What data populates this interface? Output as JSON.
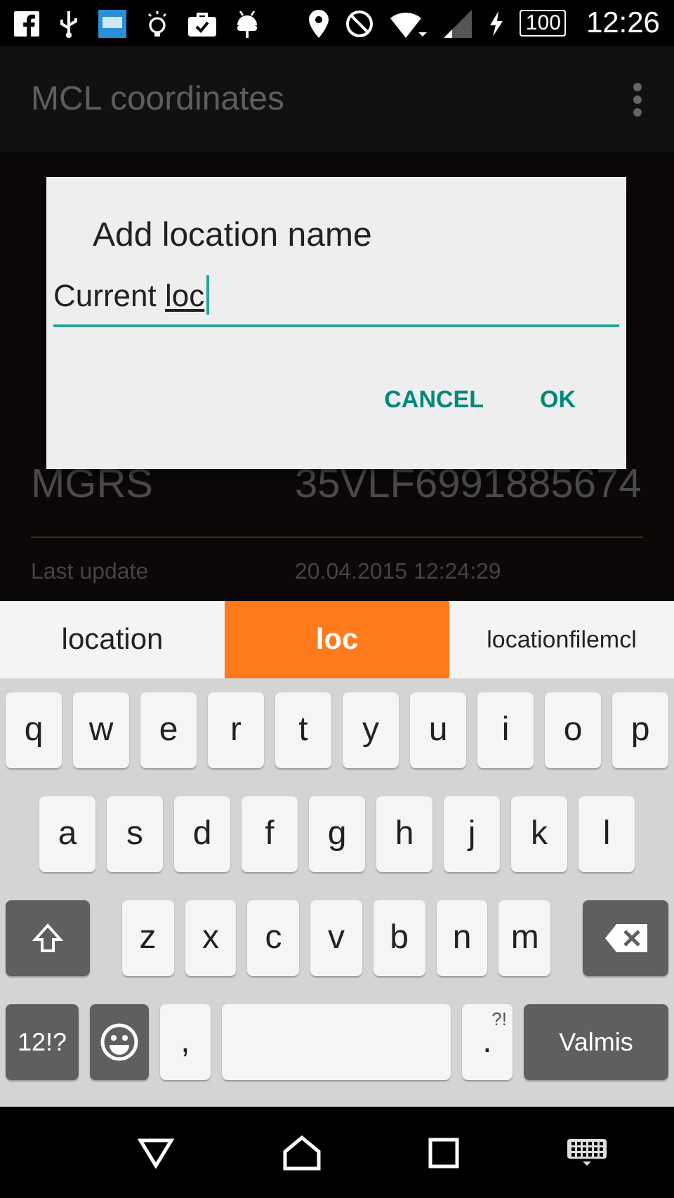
{
  "status_bar": {
    "notifications": [
      {
        "kind": "facebook"
      },
      {
        "kind": "usb"
      },
      {
        "kind": "app"
      },
      {
        "kind": "bulb"
      },
      {
        "kind": "briefcase"
      },
      {
        "kind": "android"
      }
    ],
    "system": [
      {
        "kind": "location"
      },
      {
        "kind": "block"
      },
      {
        "kind": "wifi"
      },
      {
        "kind": "signal"
      },
      {
        "kind": "charging"
      }
    ],
    "battery": "100",
    "time": "12:26"
  },
  "app_bar": {
    "title": "MCL coordinates"
  },
  "content": {
    "rows": [
      {
        "label": "MGRS",
        "value": "35VLF6991885674"
      }
    ],
    "details": [
      {
        "label": "Last update",
        "value": "20.04.2015 12:24:29"
      }
    ]
  },
  "dialog": {
    "title": "Add location name",
    "field": {
      "value": "Current ",
      "composing": "loc"
    },
    "buttons": [
      "CANCEL",
      "OK"
    ]
  },
  "keyboard": {
    "suggestions": [
      {
        "text": "location",
        "selected": false
      },
      {
        "text": "loc",
        "selected": true
      },
      {
        "text": "locationfilemcl",
        "selected": false
      }
    ],
    "rows": [
      {
        "keys": [
          {
            "kind": "letter",
            "label": "q"
          },
          {
            "kind": "letter",
            "label": "w"
          },
          {
            "kind": "letter",
            "label": "e"
          },
          {
            "kind": "letter",
            "label": "r"
          },
          {
            "kind": "letter",
            "label": "t"
          },
          {
            "kind": "letter",
            "label": "y"
          },
          {
            "kind": "letter",
            "label": "u"
          },
          {
            "kind": "letter",
            "label": "i"
          },
          {
            "kind": "letter",
            "label": "o"
          },
          {
            "kind": "letter",
            "label": "p"
          }
        ]
      },
      {
        "keys": [
          {
            "kind": "letter",
            "label": "a"
          },
          {
            "kind": "letter",
            "label": "s"
          },
          {
            "kind": "letter",
            "label": "d"
          },
          {
            "kind": "letter",
            "label": "f"
          },
          {
            "kind": "letter",
            "label": "g"
          },
          {
            "kind": "letter",
            "label": "h"
          },
          {
            "kind": "letter",
            "label": "j"
          },
          {
            "kind": "letter",
            "label": "k"
          },
          {
            "kind": "letter",
            "label": "l"
          }
        ]
      },
      {
        "keys": [
          {
            "kind": "shift"
          },
          {
            "kind": "letter",
            "label": "z"
          },
          {
            "kind": "letter",
            "label": "x"
          },
          {
            "kind": "letter",
            "label": "c"
          },
          {
            "kind": "letter",
            "label": "v"
          },
          {
            "kind": "letter",
            "label": "b"
          },
          {
            "kind": "letter",
            "label": "n"
          },
          {
            "kind": "letter",
            "label": "m"
          },
          {
            "kind": "backspace"
          }
        ]
      },
      {
        "keys": [
          {
            "kind": "symbols",
            "label": "12!?"
          },
          {
            "kind": "emoji"
          },
          {
            "kind": "punct",
            "label": ","
          },
          {
            "kind": "space"
          },
          {
            "kind": "punct",
            "label": ".",
            "hint": "?!"
          },
          {
            "kind": "action",
            "label": "Valmis"
          }
        ]
      }
    ]
  },
  "nav_bar": [
    {
      "kind": "back"
    },
    {
      "kind": "home"
    },
    {
      "kind": "recents"
    },
    {
      "kind": "keyboard"
    }
  ]
}
